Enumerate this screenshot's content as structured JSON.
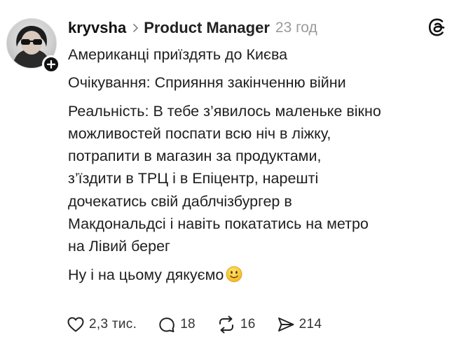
{
  "post": {
    "username": "kryvsha",
    "topic": "Product Manager",
    "timestamp": "23 год",
    "lines": [
      "Американці приїздять до Києва",
      "Очікування: Сприяння закінченню війни",
      "Реальність: В тебе з’явилось маленьке вікно",
      "можливостей поспати всю ніч в ліжку,",
      "потрапити в магазин за продуктами,",
      "з’їздити в ТРЦ і в Епіцентр, нарешті",
      "дочекатись свій даблчізбургер в",
      "Макдональдсі і навіть покататись на метро",
      "на Лівий берег",
      "Ну і на цьому дякуємо"
    ],
    "emoji": "slightly-smiling-face"
  },
  "actions": {
    "likes": "2,3 тис.",
    "replies": "18",
    "reposts": "16",
    "shares": "214"
  },
  "icons": {
    "avatar": "profile-avatar",
    "follow": "plus-icon",
    "chevron": "chevron-right-icon",
    "logo": "threads-logo-icon",
    "like": "heart-icon",
    "reply": "comment-icon",
    "repost": "repost-icon",
    "share": "send-icon"
  },
  "colors": {
    "text": "#1e1e1e",
    "muted": "#9a9a9a",
    "badge": "#111111"
  }
}
